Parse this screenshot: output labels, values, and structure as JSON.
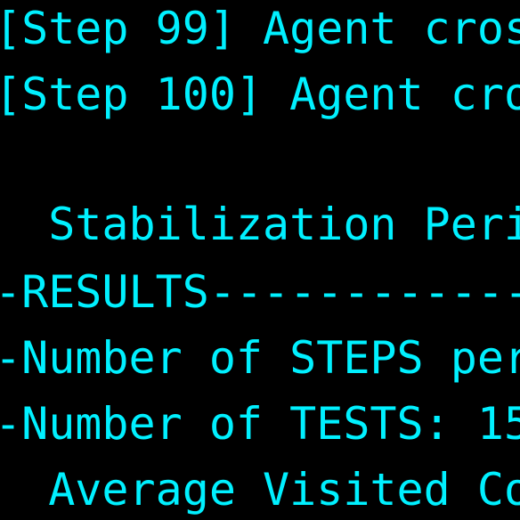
{
  "terminal": {
    "lines": [
      "[Step 99] Agent cros",
      "[Step 100] Agent cro",
      "",
      "  Stabilization Peri",
      "-RESULTS--------------------",
      "-Number of STEPS per",
      "-Number of TESTS: 15",
      "  Average Visited Co"
    ],
    "text_color": "#00f0ff",
    "background_color": "#000000"
  }
}
